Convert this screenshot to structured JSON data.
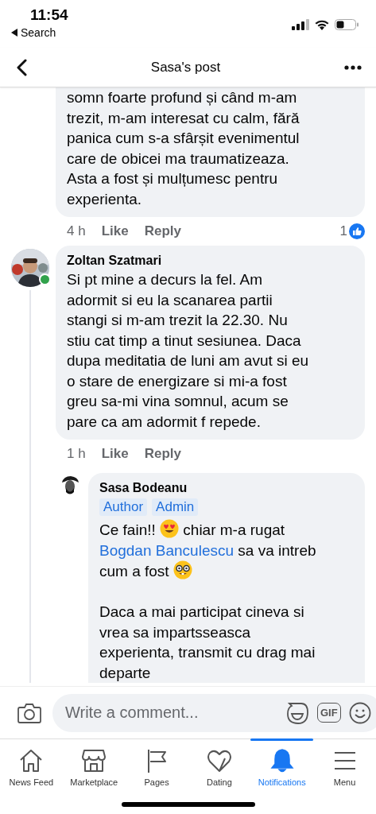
{
  "status_bar": {
    "time": "11:54",
    "back_label": "Search"
  },
  "header": {
    "title": "Sasa's post"
  },
  "comments": [
    {
      "body": [
        {
          "kind": "text",
          "text": "somn foarte profund și când m-am\ntrezit, m-am interesat cu calm, fără\npanica cum s-a sfârșit evenimentul\ncare de obicei ma traumatizeaza.\nAsta a fost și mulțumesc pentru\nexperienta."
        }
      ],
      "time": "4 h",
      "like": "Like",
      "reply": "Reply",
      "reactions": "1"
    },
    {
      "author": "Zoltan Szatmari",
      "online": true,
      "body": [
        {
          "kind": "text",
          "text": "Si pt mine a decurs la fel. Am\nadormit si eu la scanarea partii\nstangi si m-am trezit la 22.30. Nu\nstiu cat timp a tinut sesiunea. Daca\ndupa meditatia de luni am avut si eu\no stare de energizare si mi-a fost\ngreu sa-mi vina somnul, acum se\npare ca am adormit f repede."
        }
      ],
      "time": "1 h",
      "like": "Like",
      "reply": "Reply",
      "replies": [
        {
          "author": "Sasa Bodeanu",
          "badges": [
            "Author",
            "Admin"
          ],
          "body": [
            {
              "kind": "text",
              "text": "Ce fain!! "
            },
            {
              "kind": "emoji"
            },
            {
              "kind": "text",
              "text": " chiar m-a rugat\n"
            },
            {
              "kind": "mention",
              "text": "Bogdan Banculescu"
            },
            {
              "kind": "text",
              "text": " sa va intreb\ncum a fost "
            },
            {
              "kind": "emoji"
            },
            {
              "kind": "text",
              "text": "\n\nDaca a mai participat cineva si\nvrea sa impartsseasca\nexperienta, transmit cu drag mai\ndeparte"
            }
          ]
        }
      ]
    }
  ],
  "composer": {
    "placeholder": "Write a comment...",
    "gif_label": "GIF"
  },
  "tabs": [
    {
      "label": "News Feed",
      "selected": false
    },
    {
      "label": "Marketplace",
      "selected": false
    },
    {
      "label": "Pages",
      "selected": false
    },
    {
      "label": "Dating",
      "selected": false
    },
    {
      "label": "Notifications",
      "selected": true
    },
    {
      "label": "Menu",
      "selected": false
    }
  ]
}
